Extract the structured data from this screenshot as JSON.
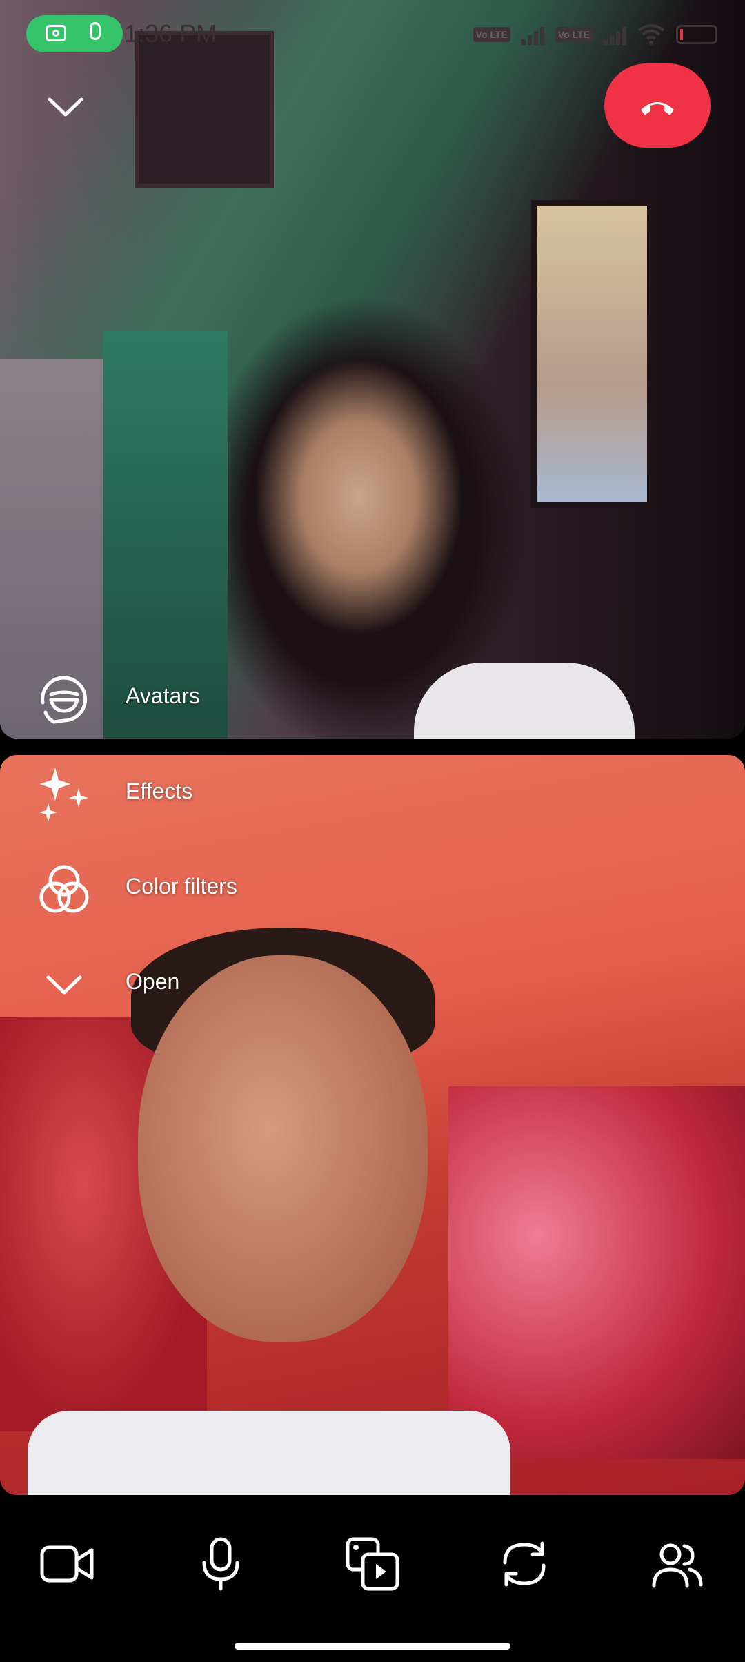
{
  "status_bar": {
    "time": "1:36 PM",
    "sim1": "Vo LTE",
    "sim2": "Vo LTE",
    "icons": [
      "camera-icon",
      "mic-icon",
      "alarm-icon",
      "notification-bell-icon",
      "signal-icon",
      "wifi-icon",
      "battery-icon"
    ],
    "battery_color": "#e33c3c",
    "recording_pill_color": "#35c46a"
  },
  "call": {
    "end_call_color": "#ef3345"
  },
  "effects_menu": {
    "items": [
      {
        "label": "Avatars",
        "icon": "avatar-icon"
      },
      {
        "label": "Effects",
        "icon": "sparkles-icon"
      },
      {
        "label": "Color filters",
        "icon": "color-filters-icon"
      },
      {
        "label": "Open",
        "icon": "chevron-down-icon"
      }
    ]
  },
  "toolbar": {
    "buttons": [
      {
        "name": "video",
        "icon": "video-camera-icon"
      },
      {
        "name": "microphone",
        "icon": "microphone-icon"
      },
      {
        "name": "share",
        "icon": "media-share-icon"
      },
      {
        "name": "flip-camera",
        "icon": "flip-camera-icon"
      },
      {
        "name": "participants",
        "icon": "people-icon"
      }
    ]
  }
}
